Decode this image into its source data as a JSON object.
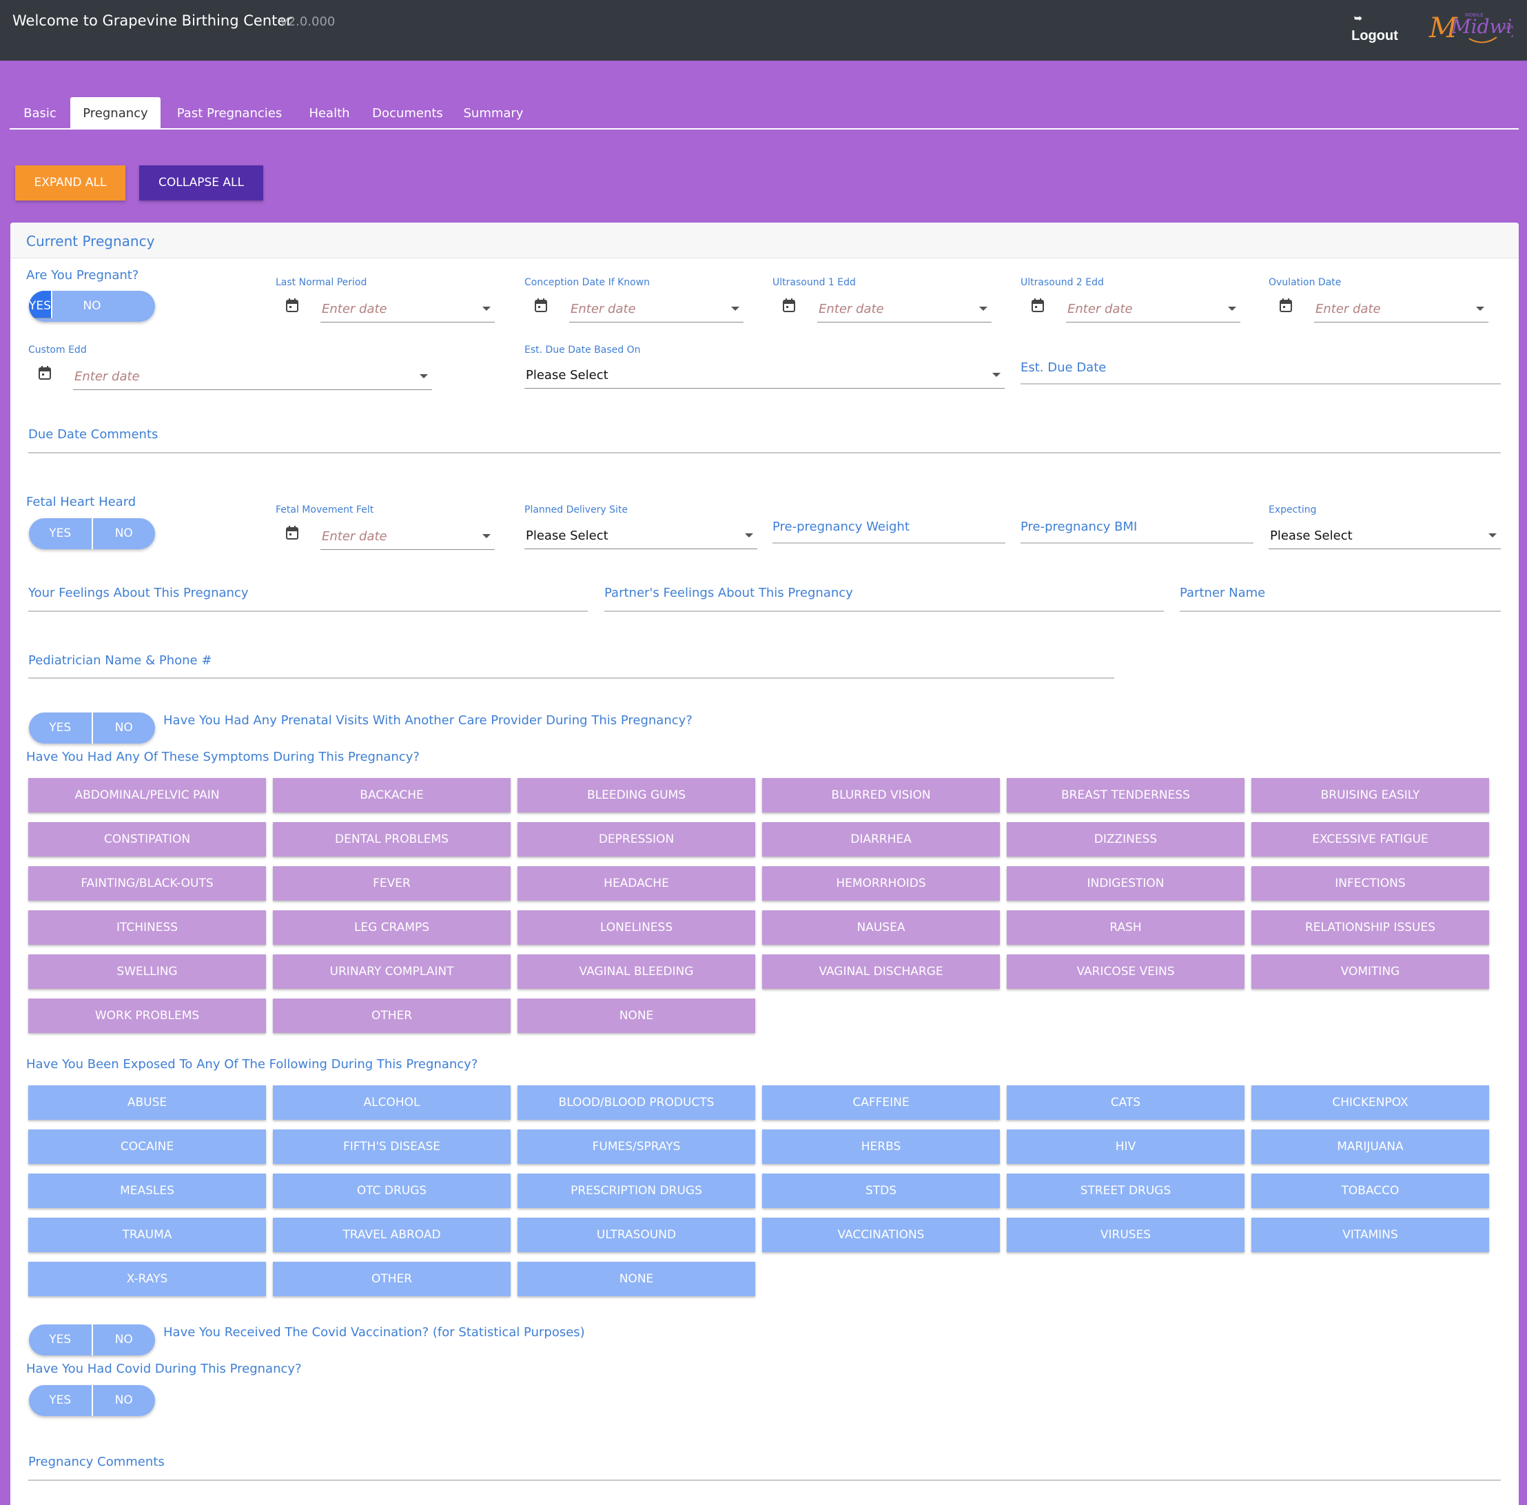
{
  "header": {
    "title": "Welcome to Grapevine Birthing Center",
    "version": "v2.0.000",
    "logout_label": "Logout",
    "logout_icon": "logout-icon",
    "logo_text": "Midwife",
    "logo_small_top": "MOBILE",
    "logo_small_side": "EHR"
  },
  "tabs": [
    {
      "label": "Basic"
    },
    {
      "label": "Pregnancy"
    },
    {
      "label": "Past Pregnancies"
    },
    {
      "label": "Health"
    },
    {
      "label": "Documents"
    },
    {
      "label": "Summary"
    }
  ],
  "actions": {
    "expand_all": "EXPAND ALL",
    "collapse_all": "COLLAPSE ALL"
  },
  "card": {
    "title": "Current Pregnancy"
  },
  "toggle": {
    "yes": "YES",
    "no": "NO"
  },
  "fields": {
    "are_you_pregnant": "Are You Pregnant?",
    "last_normal_period": "Last Normal Period",
    "conception_date": "Conception Date If Known",
    "ultrasound1": "Ultrasound 1 Edd",
    "ultrasound2": "Ultrasound 2 Edd",
    "ovulation": "Ovulation Date",
    "custom_edd": "Custom Edd",
    "est_due_based_on": "Est. Due Date Based On",
    "est_due_date": "Est. Due Date",
    "due_date_comments": "Due Date Comments",
    "fetal_heart": "Fetal Heart Heard",
    "fetal_movement": "Fetal Movement Felt",
    "planned_site": "Planned Delivery Site",
    "pre_weight": "Pre-pregnancy Weight",
    "pre_bmi": "Pre-pregnancy BMI",
    "expecting": "Expecting",
    "your_feelings": "Your Feelings About This Pregnancy",
    "partner_feelings": "Partner's Feelings About This Pregnancy",
    "partner_name": "Partner Name",
    "pediatrician": "Pediatrician Name & Phone #",
    "prenatal_visits_q": "Have You Had Any Prenatal Visits With Another Care Provider During This Pregnancy?",
    "symptoms_q": "Have You Had Any Of These Symptoms During This Pregnancy?",
    "exposed_q": "Have You Been Exposed To Any Of The Following During This Pregnancy?",
    "covid_vax_q": "Have You Received The Covid Vaccination? (for Statistical Purposes)",
    "covid_q": "Have You Had Covid During This Pregnancy?",
    "pregnancy_comments": "Pregnancy Comments",
    "date_placeholder": "Enter date",
    "please_select": "Please Select"
  },
  "symptoms": [
    "ABDOMINAL/PELVIC PAIN",
    "BACKACHE",
    "BLEEDING GUMS",
    "BLURRED VISION",
    "BREAST TENDERNESS",
    "BRUISING EASILY",
    "CONSTIPATION",
    "DENTAL PROBLEMS",
    "DEPRESSION",
    "DIARRHEA",
    "DIZZINESS",
    "EXCESSIVE FATIGUE",
    "FAINTING/BLACK-OUTS",
    "FEVER",
    "HEADACHE",
    "HEMORRHOIDS",
    "INDIGESTION",
    "INFECTIONS",
    "ITCHINESS",
    "LEG CRAMPS",
    "LONELINESS",
    "NAUSEA",
    "RASH",
    "RELATIONSHIP ISSUES",
    "SWELLING",
    "URINARY COMPLAINT",
    "VAGINAL BLEEDING",
    "VAGINAL DISCHARGE",
    "VARICOSE VEINS",
    "VOMITING",
    "WORK PROBLEMS",
    "OTHER",
    "NONE"
  ],
  "exposures": [
    "ABUSE",
    "ALCOHOL",
    "BLOOD/BLOOD PRODUCTS",
    "CAFFEINE",
    "CATS",
    "CHICKENPOX",
    "COCAINE",
    "FIFTH'S DISEASE",
    "FUMES/SPRAYS",
    "HERBS",
    "HIV",
    "MARIJUANA",
    "MEASLES",
    "OTC DRUGS",
    "PRESCRIPTION DRUGS",
    "STDS",
    "STREET DRUGS",
    "TOBACCO",
    "TRAUMA",
    "TRAVEL ABROAD",
    "ULTRASOUND",
    "VACCINATIONS",
    "VIRUSES",
    "VITAMINS",
    "X-RAYS",
    "OTHER",
    "NONE"
  ]
}
